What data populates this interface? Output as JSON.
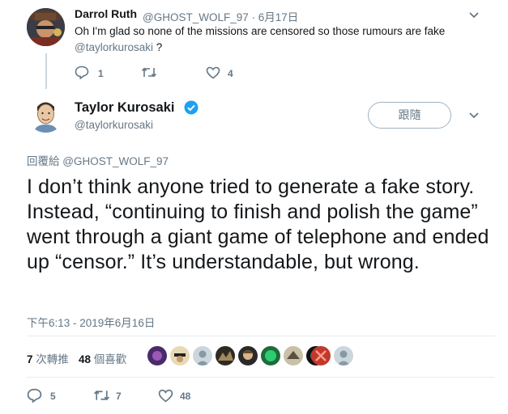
{
  "reply_tweet": {
    "author_name": "Darrol Ruth",
    "author_handle_and_date": "@GHOST_WOLF_97 · 6月17日",
    "text_line1": "Oh I'm glad so none of the missions are censored so those rumours are fake",
    "mention": "@taylorkurosaki",
    "mention_suffix": " ?",
    "reply_count": "1",
    "like_count": "4"
  },
  "main_tweet": {
    "author_name": "Taylor Kurosaki",
    "author_handle": "@taylorkurosaki",
    "follow_label": "跟隨",
    "replying_to_prefix": "回覆給 ",
    "replying_to_handle": "@GHOST_WOLF_97",
    "text": "I don’t think anyone tried to generate a fake story. Instead, “continuing to finish and polish the game” went through a giant game of telephone and ended up “censor.” It’s understandable, but wrong.",
    "timestamp": "下午6:13 - 2019年6月16日",
    "retweets_num": "7",
    "retweets_label": " 次轉推",
    "likes_num": "48",
    "likes_label": " 個喜歡",
    "reply_count": "5",
    "retweet_count": "7",
    "like_count": "48"
  },
  "colors": {
    "verified": "#1da1f2",
    "muted": "#657786",
    "text": "#14171a"
  }
}
